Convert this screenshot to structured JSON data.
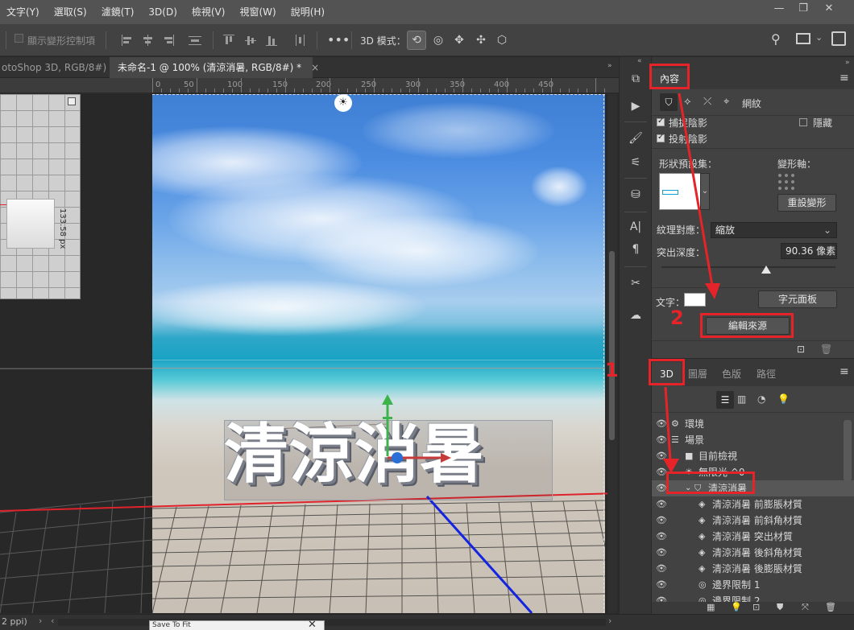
{
  "menu": [
    "文字(Y)",
    "選取(S)",
    "濾鏡(T)",
    "3D(D)",
    "檢視(V)",
    "視窗(W)",
    "說明(H)"
  ],
  "window_controls": {
    "minimize": "—",
    "restore": "❐",
    "close": "✕"
  },
  "options_bar": {
    "show_transform_label": "顯示變形控制項",
    "mode_label": "3D 模式："
  },
  "tabs": [
    {
      "label": "otoShop 3D, RGB/8#)",
      "close": "×",
      "active": false
    },
    {
      "label": "未命名-1 @ 100% (清涼消暑, RGB/8#) *",
      "close": "×",
      "active": true
    }
  ],
  "ruler": {
    "labels": [
      "0",
      "50",
      "100",
      "150",
      "200",
      "250",
      "300",
      "350",
      "400",
      "450"
    ]
  },
  "canvas": {
    "text_3d": "清涼消暑",
    "measure": "133.58 px",
    "colors": {
      "sky": "#3f7fd4",
      "sea": "#1aa2c4",
      "sand": "#cfc7bc",
      "axis_red": "#e0222a",
      "axis_blue": "#1424e0",
      "axis_green": "#3cb44b"
    }
  },
  "properties_panel": {
    "tab": "內容",
    "subtabs": {
      "mesh_label": "網紋"
    },
    "catch_shadow": "捕捉陰影",
    "cast_shadow": "投射陰影",
    "invisible": "隱藏",
    "shape_preset_label": "形狀預設集：",
    "deform_axis_label": "變形軸：",
    "reset_deform": "重設變形",
    "texture_mapping_label": "紋理對應：",
    "texture_mapping_value": "縮放",
    "extrusion_depth_label": "突出深度：",
    "extrusion_depth_value": "90.36 像素",
    "extrusion_slider": 0.6,
    "text_label": "文字：",
    "character_panel": "字元面板",
    "edit_source": "編輯來源"
  },
  "panel_3d": {
    "tabs": [
      "3D",
      "圖層",
      "色版",
      "路徑"
    ],
    "active_tab": "3D",
    "layers": [
      {
        "name": "環境",
        "icon": "environment-icon",
        "indent": 0,
        "twisty": false,
        "selected": false
      },
      {
        "name": "場景",
        "icon": "scene-icon",
        "indent": 0,
        "twisty": false,
        "selected": false
      },
      {
        "name": "目前檢視",
        "icon": "camera-icon",
        "indent": 1,
        "twisty": false,
        "selected": false
      },
      {
        "name": "無限光 ^0",
        "icon": "light-icon",
        "indent": 1,
        "twisty": false,
        "selected": false
      },
      {
        "name": "清涼消暑",
        "icon": "mesh-icon",
        "indent": 1,
        "twisty": true,
        "selected": true
      },
      {
        "name": "清涼消暑 前膨脹材質",
        "icon": "material-icon",
        "indent": 2,
        "twisty": false,
        "selected": false
      },
      {
        "name": "清涼消暑 前斜角材質",
        "icon": "material-icon",
        "indent": 2,
        "twisty": false,
        "selected": false
      },
      {
        "name": "清涼消暑 突出材質",
        "icon": "material-icon",
        "indent": 2,
        "twisty": false,
        "selected": false
      },
      {
        "name": "清涼消暑 後斜角材質",
        "icon": "material-icon",
        "indent": 2,
        "twisty": false,
        "selected": false
      },
      {
        "name": "清涼消暑 後膨脹材質",
        "icon": "material-icon",
        "indent": 2,
        "twisty": false,
        "selected": false
      },
      {
        "name": "邊界限制 1",
        "icon": "constraint-icon",
        "indent": 2,
        "twisty": false,
        "selected": false
      },
      {
        "name": "邊界限制 2",
        "icon": "constraint-icon",
        "indent": 2,
        "twisty": false,
        "selected": false
      }
    ]
  },
  "status": {
    "zoom_text": "2 ppi)",
    "mini_title": "Save To Fit"
  },
  "annotations": {
    "step1": "1",
    "step2": "2",
    "color": "#e5242a"
  }
}
